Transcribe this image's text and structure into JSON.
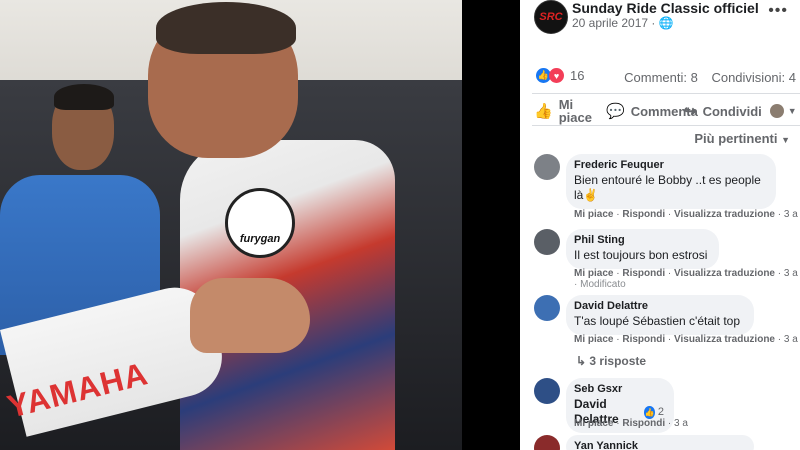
{
  "post": {
    "page_name": "Sunday Ride Classic officiel",
    "page_logo": "SRC",
    "date": "20 aprile 2017 · ",
    "more_icon": "more-dots-icon",
    "reaction_count": "16",
    "comments_count": "Commenti: 8",
    "shares_count": "Condivisioni: 4"
  },
  "actions": {
    "like": "Mi piace",
    "comment": "Commenta",
    "share": "Condividi"
  },
  "sort_label": "Più pertinenti",
  "photo": {
    "badge_text": "furygan",
    "sleeve_text": "YAMAHA"
  },
  "comments": [
    {
      "name": "Frederic Feuquer",
      "text": "Bien entouré le Bobby ..t es people là✌",
      "like": "Mi piace",
      "reply": "Rispondi",
      "translate": "Visualizza traduzione",
      "time": "3 a"
    },
    {
      "name": "Phil Sting",
      "text": "Il est toujours bon estrosi",
      "like": "Mi piace",
      "reply": "Rispondi",
      "translate": "Visualizza traduzione",
      "time": "3 a",
      "edited": "Modificato"
    },
    {
      "name": "David Delattre",
      "text": "T'as loupé Sébastien c'était top",
      "like": "Mi piace",
      "reply": "Rispondi",
      "translate": "Visualizza traduzione",
      "time": "3 a"
    },
    {
      "name": "Seb Gsxr",
      "text": "David Delattre",
      "likes": "2",
      "like": "Mi piace",
      "reply": "Rispondi",
      "time": "3 a"
    },
    {
      "name": "Yan Yannick"
    }
  ],
  "replies_label": "3 risposte",
  "colors": {
    "accent": "#1877f2",
    "love": "#f33e58",
    "bubble": "#f0f2f5"
  }
}
